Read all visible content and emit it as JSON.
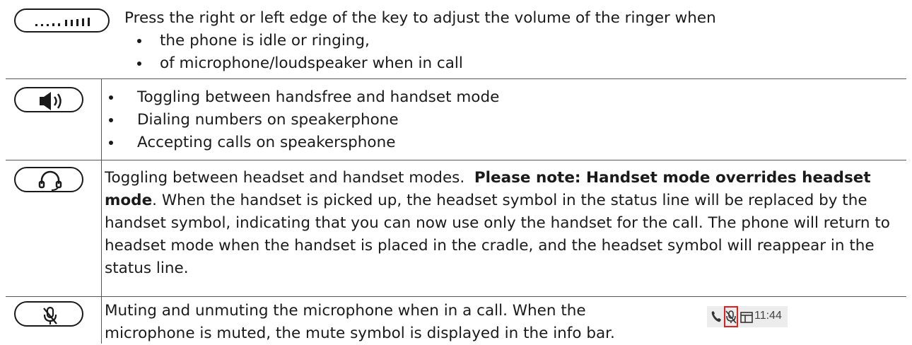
{
  "rows": [
    {
      "key_icon": "volume-rocker-icon",
      "intro": "Press the right or left edge of the key to adjust the volume of the ringer when",
      "bullets": [
        "the phone is idle or ringing,",
        "of microphone/loudspeaker when in call"
      ]
    },
    {
      "key_icon": "speaker-icon",
      "bullets": [
        "Toggling between handsfree and handset mode",
        "Dialing numbers on speakerphone",
        "Accepting calls on speakersphone"
      ]
    },
    {
      "key_icon": "headset-icon",
      "text_pre": "Toggling between headset and handset modes.  ",
      "text_bold": "Please note:  Handset mode overrides headset mode",
      "text_post": ".  When the handset is picked up, the headset symbol in the status line will be replaced by the handset symbol, indicating that you can now use only the handset for the call.  The phone will return to headset mode when the handset is placed in the cradle, and the headset symbol will reappear in the status line."
    },
    {
      "key_icon": "mute-icon",
      "text": "Muting and unmuting the microphone when in a call.  When the microphone is muted, the mute symbol is displayed in the info bar.",
      "status_bar": {
        "time": "11:44",
        "icons": [
          "phone-icon",
          "muted-mic-icon",
          "screen-icon"
        ],
        "highlight_color": "#e02020"
      }
    }
  ]
}
